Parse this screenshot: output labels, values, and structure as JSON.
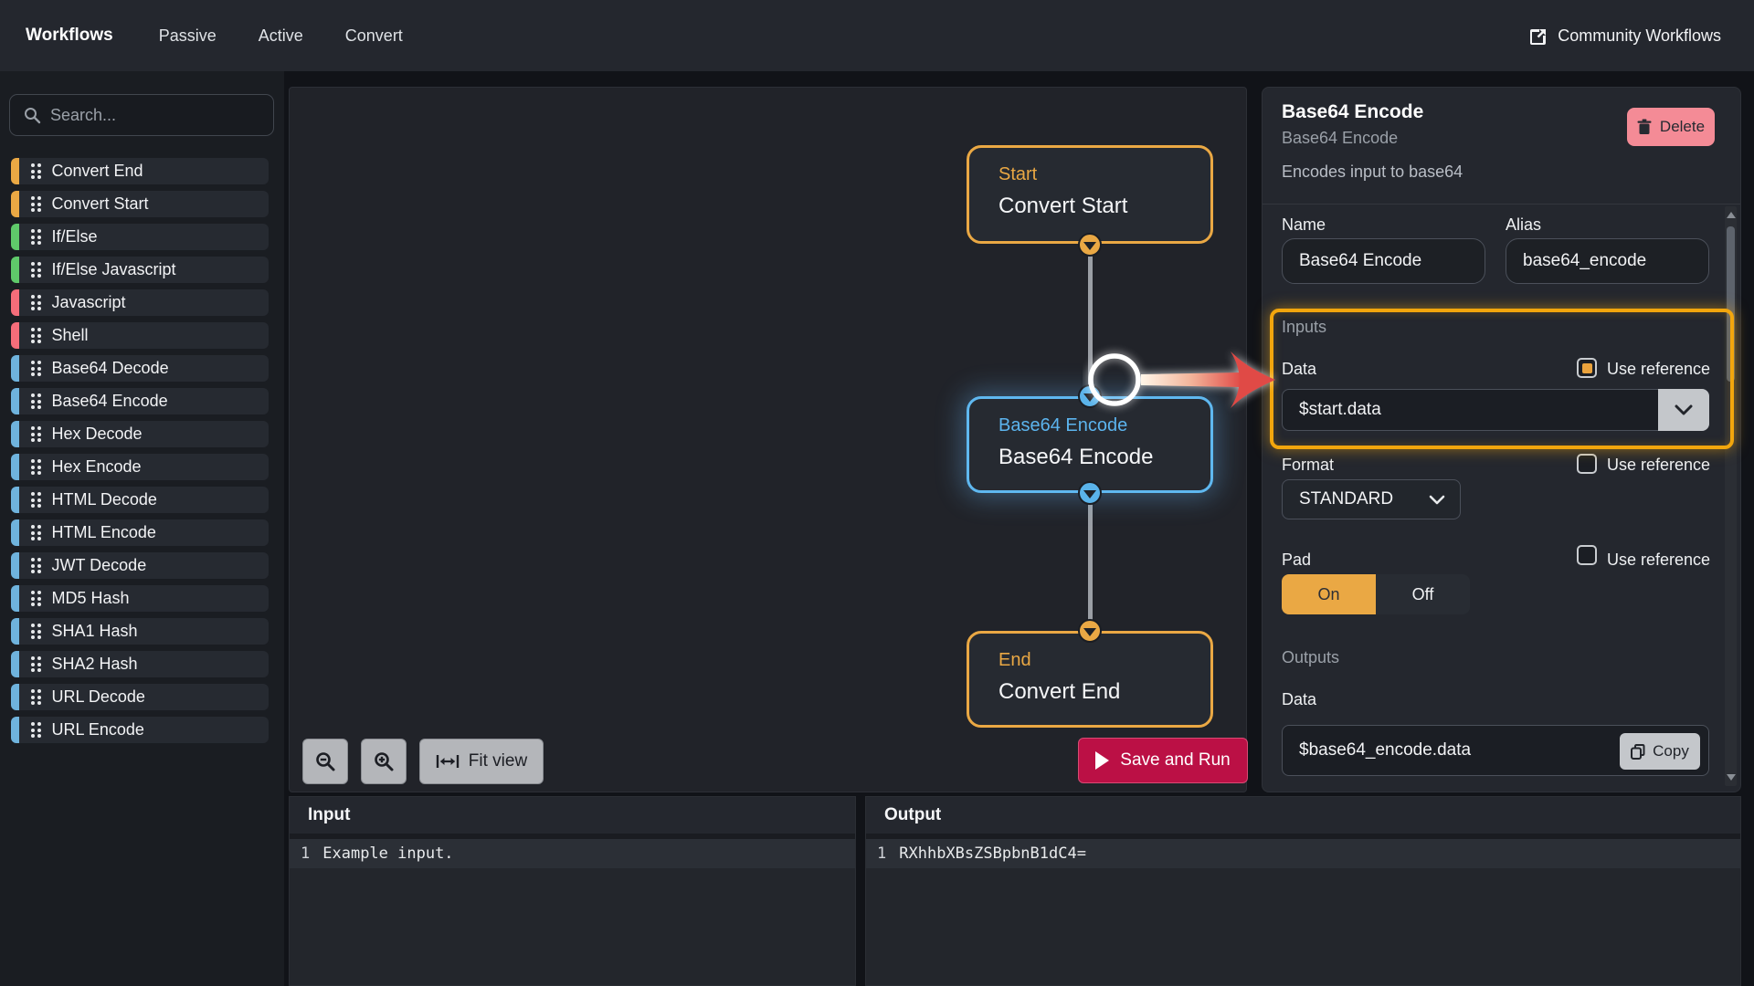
{
  "nav": {
    "brand": "Workflows",
    "tabs": [
      {
        "label": "Passive"
      },
      {
        "label": "Active"
      },
      {
        "label": "Convert"
      }
    ],
    "community_link": "Community Workflows"
  },
  "sidebar": {
    "search_placeholder": "Search...",
    "items": [
      {
        "label": "Convert End",
        "color": "amber"
      },
      {
        "label": "Convert Start",
        "color": "amber"
      },
      {
        "label": "If/Else",
        "color": "green"
      },
      {
        "label": "If/Else Javascript",
        "color": "green"
      },
      {
        "label": "Javascript",
        "color": "red"
      },
      {
        "label": "Shell",
        "color": "red"
      },
      {
        "label": "Base64 Decode",
        "color": "blue"
      },
      {
        "label": "Base64 Encode",
        "color": "blue"
      },
      {
        "label": "Hex Decode",
        "color": "blue"
      },
      {
        "label": "Hex Encode",
        "color": "blue"
      },
      {
        "label": "HTML Decode",
        "color": "blue"
      },
      {
        "label": "HTML Encode",
        "color": "blue"
      },
      {
        "label": "JWT Decode",
        "color": "blue"
      },
      {
        "label": "MD5 Hash",
        "color": "blue"
      },
      {
        "label": "SHA1 Hash",
        "color": "blue"
      },
      {
        "label": "SHA2 Hash",
        "color": "blue"
      },
      {
        "label": "URL Decode",
        "color": "blue"
      },
      {
        "label": "URL Encode",
        "color": "blue"
      }
    ]
  },
  "canvas": {
    "nodes": {
      "start": {
        "label": "Start",
        "name": "Convert Start"
      },
      "action": {
        "label": "Base64 Encode",
        "name": "Base64 Encode"
      },
      "end": {
        "label": "End",
        "name": "Convert End"
      }
    },
    "fit_view_label": "Fit view",
    "run_label": "Save and Run"
  },
  "inspector": {
    "title": "Base64 Encode",
    "subtitle": "Base64 Encode",
    "description": "Encodes input to base64",
    "delete_label": "Delete",
    "name_label": "Name",
    "name_value": "Base64 Encode",
    "alias_label": "Alias",
    "alias_value": "base64_encode",
    "inputs_label": "Inputs",
    "data_label": "Data",
    "use_reference_label": "Use reference",
    "data_value": "$start.data",
    "data_use_reference_checked": true,
    "format_label": "Format",
    "format_value": "STANDARD",
    "format_use_reference_checked": false,
    "pad_label": "Pad",
    "pad_on_label": "On",
    "pad_off_label": "Off",
    "pad_value": "On",
    "pad_use_reference_checked": false,
    "outputs_label": "Outputs",
    "output_data_label": "Data",
    "output_value": "$base64_encode.data",
    "copy_label": "Copy"
  },
  "io": {
    "input_title": "Input",
    "input_line_number": "1",
    "input_line_text": "Example input.",
    "output_title": "Output",
    "output_line_number": "1",
    "output_line_text": "RXhhbXBsZSBpbnB1dC4="
  },
  "colors": {
    "amber": "#eaa844",
    "green": "#5fc96a",
    "red": "#f56d7a",
    "blue": "#6fb3dd",
    "selected_node": "#5fb8f0",
    "highlight": "#f2a60d",
    "run_button": "#bb1045",
    "delete_button": "#f48b96"
  }
}
